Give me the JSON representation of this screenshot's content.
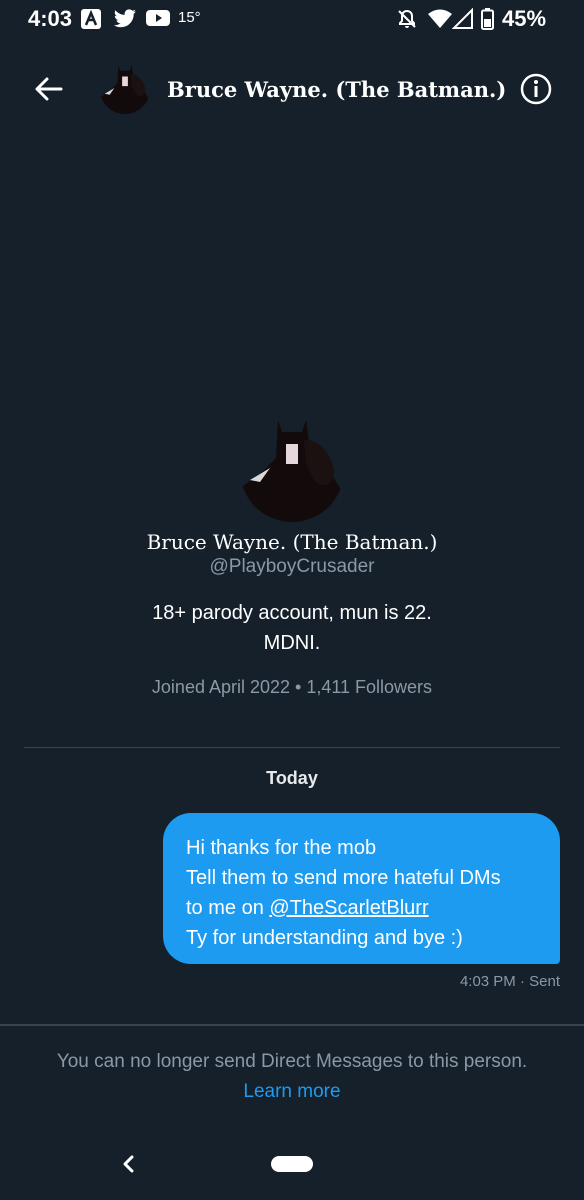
{
  "status_bar": {
    "time": "4:03",
    "temperature": "15°",
    "battery": "45%",
    "icons": [
      "a-app-icon",
      "twitter-icon",
      "youtube-icon",
      "notifications-off-icon",
      "wifi-icon",
      "signal-icon",
      "battery-icon"
    ]
  },
  "header": {
    "back_icon": "arrow-left-icon",
    "title": "Bruce Wayne. (The Batman.)",
    "info_icon": "info-icon"
  },
  "profile": {
    "name": "Bruce Wayne. (The Batman.)",
    "handle": "@PlayboyCrusader",
    "bio_line1": "18+ parody account, mun is 22.",
    "bio_line2": "MDNI.",
    "meta": "Joined April 2022 • 1,411 Followers"
  },
  "conversation": {
    "date_label": "Today",
    "message": {
      "line1": "Hi thanks for the mob",
      "line2": "Tell them to send more hateful DMs",
      "line3_prefix": "to me on ",
      "line3_mention": "@TheScarletBlurr",
      "line4": "Ty for understanding and bye :)",
      "meta": "4:03 PM · Sent"
    }
  },
  "footer": {
    "notice": "You can no longer send Direct Messages to this person.",
    "learn_more": "Learn more"
  },
  "colors": {
    "background": "#15202b",
    "accent": "#1d9bf0",
    "secondary_text": "#8b98a5"
  }
}
